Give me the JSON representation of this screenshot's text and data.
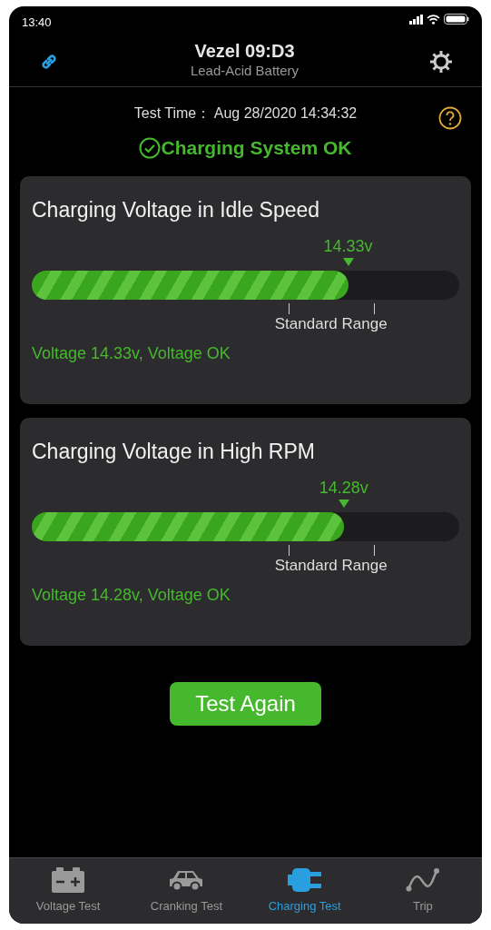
{
  "status_bar": {
    "time": "13:40"
  },
  "header": {
    "title": "Vezel 09:D3",
    "subtitle": "Lead-Acid Battery"
  },
  "test_time": {
    "label": "Test Time：",
    "value": "Aug 28/2020 14:34:32"
  },
  "result": {
    "text": "Charging System OK",
    "ok": true
  },
  "tests": [
    {
      "title": "Charging Voltage in Idle Speed",
      "reading": "14.33v",
      "level": 0.74,
      "range_label": "Standard Range",
      "message": "Voltage 14.33v, Voltage OK",
      "ok": true
    },
    {
      "title": "Charging Voltage in High RPM",
      "reading": "14.28v",
      "level": 0.73,
      "range_label": "Standard Range",
      "message": "Voltage 14.28v, Voltage OK",
      "ok": true
    }
  ],
  "action_button": "Test Again",
  "tabs": [
    {
      "label": "Voltage Test",
      "selected": false
    },
    {
      "label": "Cranking Test",
      "selected": false
    },
    {
      "label": "Charging Test",
      "selected": true
    },
    {
      "label": "Trip",
      "selected": false
    }
  ]
}
